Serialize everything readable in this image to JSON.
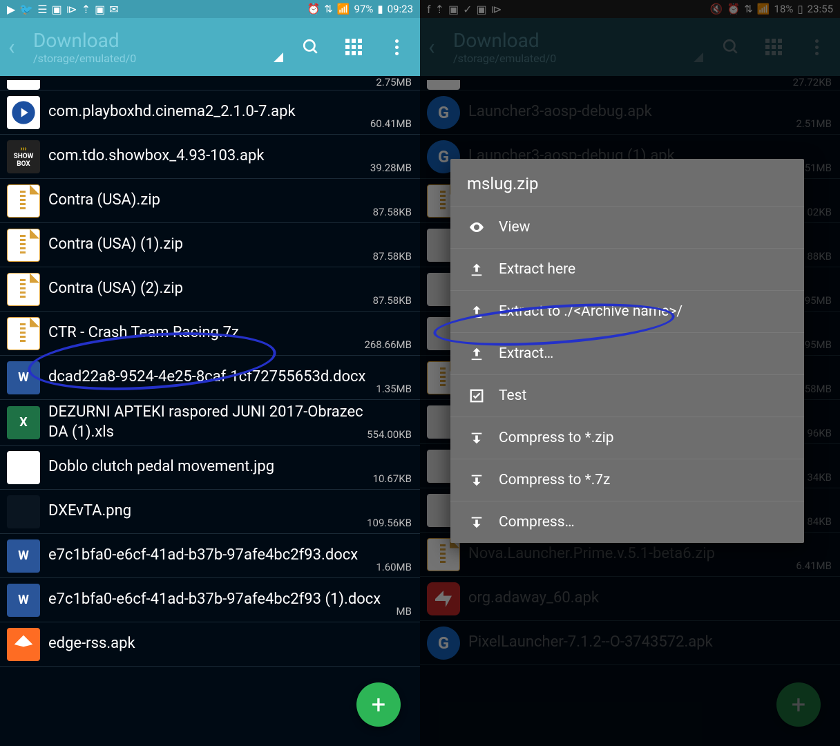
{
  "left": {
    "status": {
      "time": "09:23",
      "battery": "97%",
      "icons_left": [
        "youtube",
        "twitter",
        "menu",
        "image",
        "play",
        "upload",
        "image",
        "chat"
      ],
      "icons_right": [
        "alarm",
        "wifi",
        "signal",
        "battery"
      ]
    },
    "header": {
      "title": "Download",
      "subtitle": "/storage/emulated/0"
    },
    "files": [
      {
        "name": "",
        "size": "2.75MB",
        "icon": "partial"
      },
      {
        "name": "com.playboxhd.cinema2_2.1.0-7.apk",
        "size": "60.41MB",
        "icon": "playbox"
      },
      {
        "name": "com.tdo.showbox_4.93-103.apk",
        "size": "39.28MB",
        "icon": "showbox"
      },
      {
        "name": "Contra (USA).zip",
        "size": "87.58KB",
        "icon": "zip"
      },
      {
        "name": "Contra (USA) (1).zip",
        "size": "87.58KB",
        "icon": "zip"
      },
      {
        "name": "Contra (USA) (2).zip",
        "size": "87.58KB",
        "icon": "zip"
      },
      {
        "name": "CTR - Crash Team Racing.7z",
        "size": "268.66MB",
        "icon": "zip"
      },
      {
        "name": "dcad22a8-9524-4e25-8caf-1cf72755653d.docx",
        "size": "1.35MB",
        "icon": "doc"
      },
      {
        "name": "DEZURNI APTEKI raspored JUNI 2017-Obrazec DA (1).xls",
        "size": "554.00KB",
        "icon": "xls"
      },
      {
        "name": "Doblo clutch pedal movement.jpg",
        "size": "10.67KB",
        "icon": "jpg"
      },
      {
        "name": "DXEvTA.png",
        "size": "109.56KB",
        "icon": "png"
      },
      {
        "name": "e7c1bfa0-e6cf-41ad-b37b-97afe4bc2f93.docx",
        "size": "1.60MB",
        "icon": "doc"
      },
      {
        "name": "e7c1bfa0-e6cf-41ad-b37b-97afe4bc2f93 (1).docx",
        "size": "MB",
        "icon": "doc"
      },
      {
        "name": "edge-rss.apk",
        "size": "",
        "icon": "edge"
      }
    ]
  },
  "right": {
    "status": {
      "time": "23:55",
      "battery": "18%",
      "icons_left": [
        "facebook",
        "upload",
        "image",
        "check",
        "image",
        "play"
      ],
      "icons_right": [
        "mute",
        "alarm",
        "wifi",
        "signal",
        "battery"
      ]
    },
    "header": {
      "title": "Download",
      "subtitle": "/storage/emulated/0"
    },
    "files": [
      {
        "name": "",
        "size": "27.72KB",
        "icon": "partial"
      },
      {
        "name": "Launcher3-aosp-debug.apk",
        "size": "2.51MB",
        "icon": "g"
      },
      {
        "name": "Launcher3-aosp-debug (1).apk",
        "size": "51MB",
        "icon": "g"
      },
      {
        "name": "",
        "size": "02KB",
        "icon": "zip"
      },
      {
        "name": "",
        "size": "88KB",
        "icon": "thumb"
      },
      {
        "name": "",
        "size": "95MB",
        "icon": "thumb"
      },
      {
        "name": "",
        "size": "95MB",
        "icon": "thumb"
      },
      {
        "name": "",
        "size": "58MB",
        "icon": "zip"
      },
      {
        "name": "",
        "size": "96KB",
        "icon": "thumb"
      },
      {
        "name": "",
        "size": "34KB",
        "icon": "thumb"
      },
      {
        "name": "",
        "size": "84KB",
        "icon": "thumb"
      },
      {
        "name": "Nova.Launcher.Prime.v.5.1-beta6.zip",
        "size": "6.41MB",
        "icon": "zip"
      },
      {
        "name": "org.adaway_60.apk",
        "size": "",
        "icon": "red"
      },
      {
        "name": "PixelLauncher-7.1.2--O-3743572.apk",
        "size": "",
        "icon": "g"
      }
    ],
    "popup": {
      "title": "mslug.zip",
      "items": [
        {
          "icon": "eye",
          "label": "View"
        },
        {
          "icon": "up",
          "label": "Extract here"
        },
        {
          "icon": "up",
          "label": "Extract to ./<Archive name>/"
        },
        {
          "icon": "up",
          "label": "Extract…"
        },
        {
          "icon": "check",
          "label": "Test"
        },
        {
          "icon": "down",
          "label": "Compress to *.zip"
        },
        {
          "icon": "down",
          "label": "Compress to *.7z"
        },
        {
          "icon": "down",
          "label": "Compress…"
        }
      ]
    }
  }
}
